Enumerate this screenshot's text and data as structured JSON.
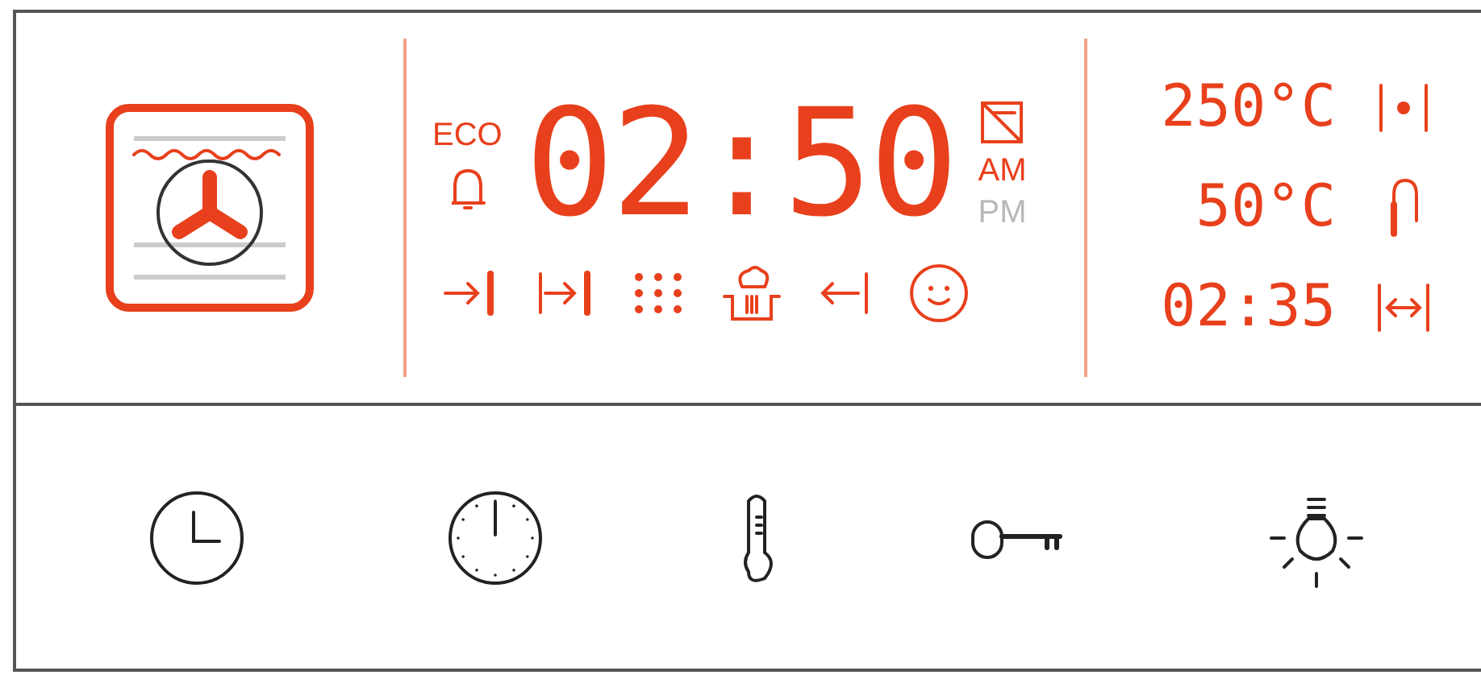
{
  "display": {
    "mode": {
      "kind": "fan"
    },
    "eco": "ECO",
    "time": "02:50",
    "meridiem": [
      {
        "label": "AM",
        "selected": true
      },
      {
        "label": "PM",
        "selected": false
      }
    ],
    "functions": [
      {
        "kind": "start"
      },
      {
        "kind": "end"
      },
      {
        "kind": "grid"
      },
      {
        "kind": "steam"
      },
      {
        "kind": "return"
      },
      {
        "kind": "child"
      }
    ],
    "readings": [
      {
        "value": "250°C",
        "kind": "heat"
      },
      {
        "value": "50°C",
        "kind": "probe"
      },
      {
        "value": "02:35",
        "kind": "duration"
      }
    ]
  },
  "buttons": [
    {
      "kind": "clock"
    },
    {
      "kind": "timer"
    },
    {
      "kind": "thermometer"
    },
    {
      "kind": "key"
    },
    {
      "kind": "light"
    }
  ]
}
